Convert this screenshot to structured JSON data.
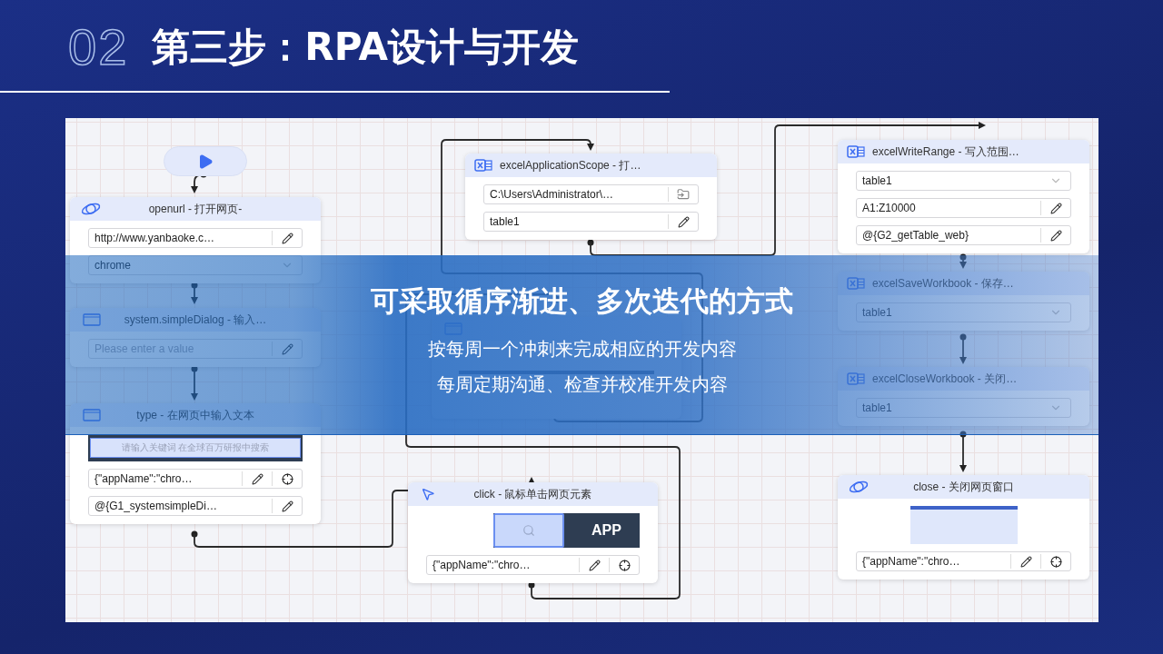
{
  "header": {
    "number": "02",
    "title": "第三步：RPA设计与开发"
  },
  "canvas": {
    "nodes": [
      {
        "kind": "browser",
        "title": "openurl - 打开网页-",
        "fields": [
          {
            "kind": "edit",
            "value": "http://www.yanbaoke.c…"
          },
          {
            "kind": "dropdown",
            "value": "chrome"
          }
        ]
      },
      {
        "kind": "dialog",
        "title": "system.simpleDialog - 输入…",
        "fields": [
          {
            "kind": "edit",
            "placeholder": "Please enter a value"
          }
        ]
      },
      {
        "kind": "dialog",
        "title": "type - 在网页中输入文本",
        "preview": {
          "kind": "search-strip",
          "text": "请输入关键词 在全球百万研报中搜索"
        },
        "fields": [
          {
            "kind": "edit-target",
            "value": "{\"appName\":\"chro…"
          },
          {
            "kind": "edit",
            "value": "@{G1_systemsimpleDi…"
          }
        ]
      },
      {
        "kind": "excel",
        "title": "excelApplicationScope - 打…",
        "fields": [
          {
            "kind": "folder",
            "value": "C:\\Users\\Administrator\\…"
          },
          {
            "kind": "edit",
            "value": "table1"
          }
        ]
      },
      {
        "kind": "dialog",
        "preview": {
          "kind": "table-strip"
        }
      },
      {
        "kind": "cursor",
        "title": "click - 鼠标单击网页元素",
        "preview": {
          "kind": "app-strip",
          "text": "APP"
        },
        "fields": [
          {
            "kind": "edit-target",
            "value": "{\"appName\":\"chro…"
          }
        ]
      },
      {
        "kind": "excel",
        "title": "excelWriteRange - 写入范围…",
        "fields": [
          {
            "kind": "dropdown",
            "value": "table1"
          },
          {
            "kind": "edit",
            "value": "A1:Z10000"
          },
          {
            "kind": "edit",
            "value": "@{G2_getTable_web}"
          }
        ]
      },
      {
        "kind": "excel",
        "title": "excelSaveWorkbook - 保存…",
        "fields": [
          {
            "kind": "dropdown",
            "value": "table1"
          }
        ]
      },
      {
        "kind": "excel",
        "title": "excelCloseWorkbook - 关闭…",
        "fields": [
          {
            "kind": "dropdown",
            "value": "table1"
          }
        ]
      },
      {
        "kind": "browser",
        "title": "close - 关闭网页窗口",
        "preview": {
          "kind": "screenshot"
        },
        "fields": [
          {
            "kind": "edit-target",
            "value": "{\"appName\":\"chro…"
          }
        ]
      }
    ]
  },
  "banner": {
    "heading": "可采取循序渐进、多次迭代的方式",
    "lines": [
      "按每周一个冲刺来完成相应的开发内容",
      "每周定期沟通、检查并校准开发内容"
    ]
  }
}
